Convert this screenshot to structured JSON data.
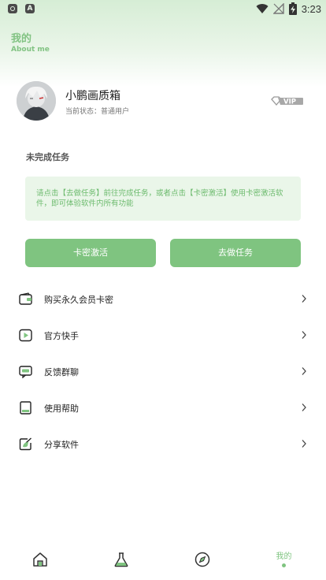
{
  "status_bar": {
    "time": "3:23",
    "left_icons": [
      "notification-icon",
      "app-a-icon"
    ],
    "right_icons": [
      "wifi-icon",
      "signal-icon",
      "battery-icon"
    ]
  },
  "header": {
    "title": "我的",
    "subtitle": "About me"
  },
  "profile": {
    "username": "小鹏画质箱",
    "status": "当前状态：普通用户",
    "badge": "VIP"
  },
  "tasks": {
    "section_title": "未完成任务",
    "notice": "请点击【去做任务】前往完成任务，或者点击【卡密激活】使用卡密激活软件，即可体验软件内所有功能",
    "buttons": {
      "activate": "卡密激活",
      "do_task": "去做任务"
    }
  },
  "menu": [
    {
      "label": "购买永久会员卡密",
      "icon": "wallet-icon"
    },
    {
      "label": "官方快手",
      "icon": "video-play-icon"
    },
    {
      "label": "反馈群聊",
      "icon": "chat-icon"
    },
    {
      "label": "使用帮助",
      "icon": "book-icon"
    },
    {
      "label": "分享软件",
      "icon": "share-icon"
    }
  ],
  "bottom_nav": [
    {
      "icon": "home-icon",
      "label": ""
    },
    {
      "icon": "flask-icon",
      "label": ""
    },
    {
      "icon": "compass-icon",
      "label": ""
    },
    {
      "icon": "",
      "label": "我的",
      "active": true
    }
  ],
  "colors": {
    "accent": "#7fc480",
    "header_bg": "#d6edd5",
    "notice_bg": "#eaf6e9",
    "notice_text": "#6dbb6e"
  }
}
